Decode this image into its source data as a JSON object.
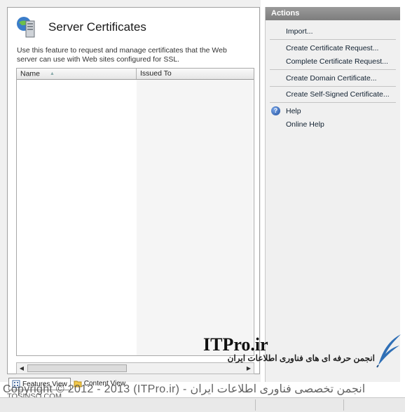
{
  "header": {
    "title": "Server Certificates",
    "icon": "server-icon"
  },
  "description": "Use this feature to request and manage certificates that the Web server can use with Web sites configured for SSL.",
  "table": {
    "columns": [
      {
        "label": "Name",
        "sorted": "ascending"
      },
      {
        "label": "Issued To"
      }
    ],
    "rows": []
  },
  "bottom_tabs": [
    {
      "label": "Features View",
      "active": true,
      "icon": "features-view-icon"
    },
    {
      "label": "Content View",
      "active": false,
      "icon": "content-view-icon"
    }
  ],
  "actions": {
    "title": "Actions",
    "items": [
      {
        "label": "Import..."
      },
      {
        "label": "Create Certificate Request..."
      },
      {
        "label": "Complete Certificate Request..."
      },
      {
        "label": "Create Domain Certificate..."
      },
      {
        "label": "Create Self-Signed Certificate..."
      },
      {
        "label": "Help",
        "icon": "help-icon"
      },
      {
        "label": "Online Help"
      }
    ]
  },
  "watermark": {
    "brand": "ITPro.ir",
    "subtitle": "انجمن حرفه ای های فناوری اطلاعات ایران",
    "copyright": "Copyright © 2012 - 2013 (ITPro.ir) - انجمن تخصصی فناوری اطلاعات ایران",
    "site": "TOSINSO.COM"
  },
  "colors": {
    "actions_header_bg": "#8a8a8a",
    "link": "#102030",
    "panel_bg": "#f0f0f0"
  }
}
